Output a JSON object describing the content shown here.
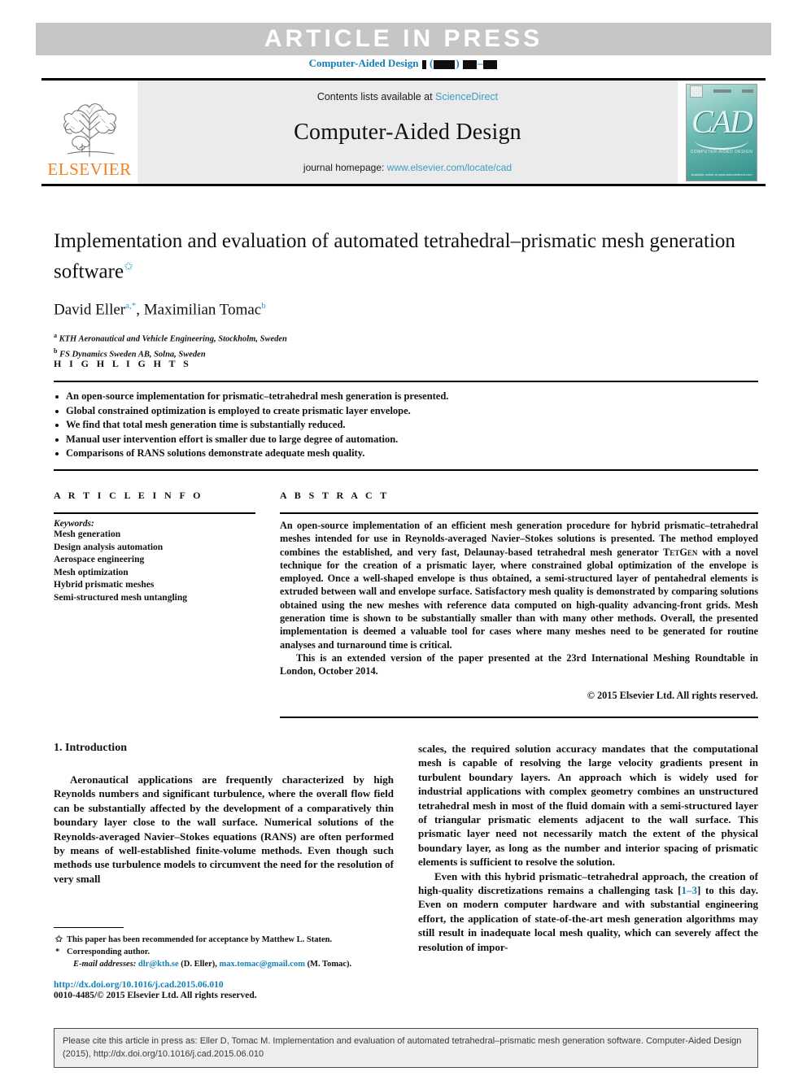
{
  "banner": {
    "article_in_press": "ARTICLE IN PRESS",
    "journal_ref_prefix": "Computer-Aided Design"
  },
  "masthead": {
    "contents_prefix": "Contents lists available at ",
    "sciencedirect": "ScienceDirect",
    "journal_title": "Computer-Aided Design",
    "homepage_prefix": "journal homepage: ",
    "homepage_url": "www.elsevier.com/locate/cad",
    "publisher": "ELSEVIER",
    "cover_title": "CAD",
    "cover_subtitle": "COMPUTER-AIDED DESIGN",
    "cover_footer": "Available online at www.sciencedirect.com",
    "teal": "#2f9189",
    "orange": "#f08121",
    "link_blue": "#3d9cc9"
  },
  "article": {
    "title": "Implementation and evaluation of automated tetrahedral–prismatic mesh generation software",
    "title_footnote_mark": "✩",
    "authors_part1": "David Eller",
    "authors_sup1": "a,*",
    "authors_part2": ", Maximilian Tomac",
    "authors_sup2": "b",
    "affiliations": [
      {
        "mark": "a",
        "text": "KTH Aeronautical and Vehicle Engineering, Stockholm, Sweden"
      },
      {
        "mark": "b",
        "text": "FS Dynamics Sweden AB, Solna, Sweden"
      }
    ]
  },
  "highlights": {
    "label": "H I G H L I G H T S",
    "items": [
      "An open-source implementation for prismatic–tetrahedral mesh generation is presented.",
      "Global constrained optimization is employed to create prismatic layer envelope.",
      "We find that total mesh generation time is substantially reduced.",
      "Manual user intervention effort is smaller due to large degree of automation.",
      "Comparisons of RANS solutions demonstrate adequate mesh quality."
    ]
  },
  "article_info": {
    "label": "A R T I C L E    I N F O",
    "keywords_heading": "Keywords:",
    "keywords": [
      "Mesh generation",
      "Design analysis automation",
      "Aerospace engineering",
      "Mesh optimization",
      "Hybrid prismatic meshes",
      "Semi-structured mesh untangling"
    ]
  },
  "abstract": {
    "label": "A B S T R A C T",
    "paragraph1_a": "An open-source implementation of an efficient mesh generation procedure for hybrid prismatic–tetrahedral meshes intended for use in Reynolds-averaged Navier–Stokes solutions is presented. The method employed combines the established, and very fast, Delaunay-based tetrahedral mesh generator ",
    "tetgen": "TetGen",
    "paragraph1_b": " with a novel technique for the creation of a prismatic layer, where constrained global optimization of the envelope is employed. Once a well-shaped envelope is thus obtained, a semi-structured layer of pentahedral elements is extruded between wall and envelope surface. Satisfactory mesh quality is demonstrated by comparing solutions obtained using the new meshes with reference data computed on high-quality advancing-front grids. Mesh generation time is shown to be substantially smaller than with many other methods. Overall, the presented implementation is deemed a valuable tool for cases where many meshes need to be generated for routine analyses and turnaround time is critical.",
    "paragraph2": "This is an extended version of the paper presented at the 23rd International Meshing Roundtable in London, October 2014.",
    "copyright": "© 2015 Elsevier Ltd. All rights reserved."
  },
  "body": {
    "section_heading": "1. Introduction",
    "left_paragraph": "Aeronautical applications are frequently characterized by high Reynolds numbers and significant turbulence, where the overall flow field can be substantially affected by the development of a comparatively thin boundary layer close to the wall surface. Numerical solutions of the Reynolds-averaged Navier–Stokes equations (RANS) are often performed by means of well-established finite-volume methods. Even though such methods use turbulence models to circumvent the need for the resolution of very small",
    "right_paragraph1": "scales, the required solution accuracy mandates that the computational mesh is capable of resolving the large velocity gradients present in turbulent boundary layers. An approach which is widely used for industrial applications with complex geometry combines an unstructured tetrahedral mesh in most of the fluid domain with a semi-structured layer of triangular prismatic elements adjacent to the wall surface. This prismatic layer need not necessarily match the extent of the physical boundary layer, as long as the number and interior spacing of prismatic elements is sufficient to resolve the solution.",
    "right_paragraph2_a": "Even with this hybrid prismatic–tetrahedral approach, the creation of high-quality discretizations remains a challenging task [",
    "right_citation": "1–3",
    "right_paragraph2_b": "] to this day. Even on modern computer hardware and with substantial engineering effort, the application of state-of-the-art mesh generation algorithms may still result in inadequate local mesh quality, which can severely affect the resolution of impor-"
  },
  "footnotes": {
    "star_mark": "✩",
    "star_text": "This paper has been recommended for acceptance by Matthew L. Staten.",
    "asterisk_mark": "*",
    "corresponding_text": "Corresponding author.",
    "email_label": "E-mail addresses:",
    "email1": "dlr@kth.se",
    "email1_owner": " (D. Eller), ",
    "email2": "max.tomac@gmail.com",
    "email2_owner": " (M. Tomac).",
    "doi": "http://dx.doi.org/10.1016/j.cad.2015.06.010",
    "issn": "0010-4485/© 2015 Elsevier Ltd. All rights reserved."
  },
  "cite_box": {
    "text": "Please cite this article in press as: Eller D, Tomac M. Implementation and evaluation of automated tetrahedral–prismatic mesh generation software. Computer-Aided Design (2015), http://dx.doi.org/10.1016/j.cad.2015.06.010"
  }
}
